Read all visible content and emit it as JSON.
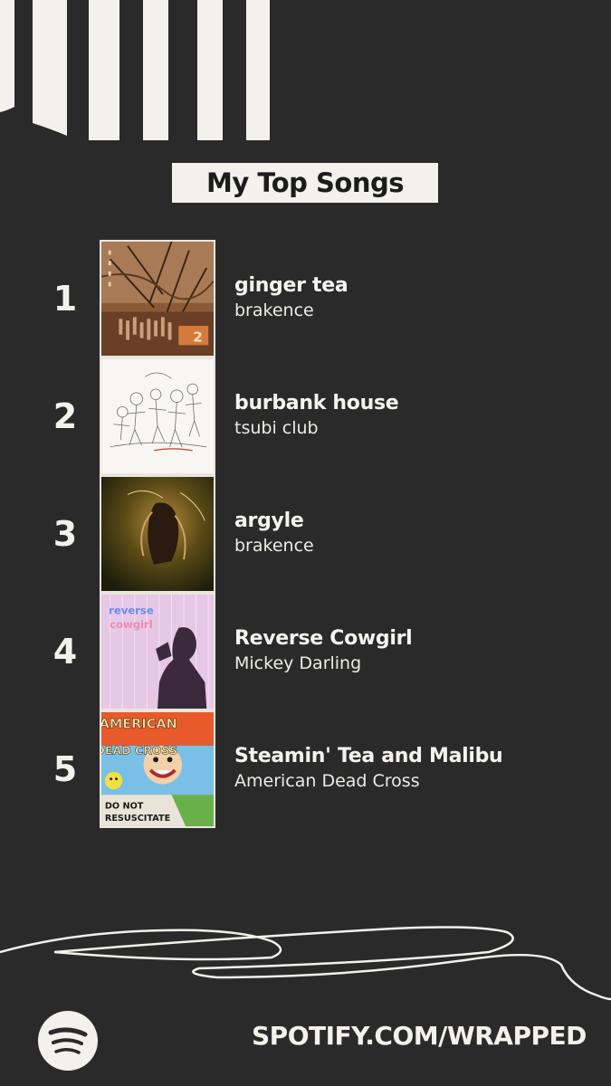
{
  "header": {
    "title": "My Top Songs"
  },
  "songs": [
    {
      "rank": "1",
      "title": "ginger tea",
      "artist": "brakence",
      "cover": "ginger-tea-cover"
    },
    {
      "rank": "2",
      "title": "burbank house",
      "artist": "tsubi club",
      "cover": "burbank-house-cover"
    },
    {
      "rank": "3",
      "title": "argyle",
      "artist": "brakence",
      "cover": "argyle-cover"
    },
    {
      "rank": "4",
      "title": "Reverse Cowgirl",
      "artist": "Mickey Darling",
      "cover": "reverse-cowgirl-cover"
    },
    {
      "rank": "5",
      "title": "Steamin' Tea and Malibu",
      "artist": "American Dead Cross",
      "cover": "american-dead-cross-cover"
    }
  ],
  "covers": {
    "cover2_text": "",
    "cover4_text": "reverse cowgirl",
    "cover5_top": "AMERICAN",
    "cover5_mid": "DEAD CROSS",
    "cover5_bottom1": "DO NOT",
    "cover5_bottom2": "RESUSCITATE",
    "cover1_badge": "2"
  },
  "footer": {
    "url": "SPOTIFY.COM/WRAPPED",
    "logo_icon": "spotify-logo-icon"
  },
  "colors": {
    "background": "#2b2a2a",
    "accent": "#f2f1ec"
  }
}
